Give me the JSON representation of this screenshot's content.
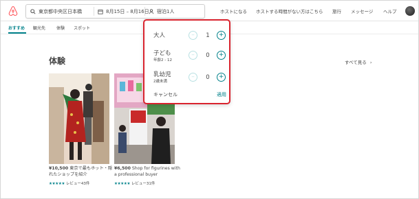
{
  "header": {
    "search": {
      "location": "東京都中央区日本橋",
      "dates": "8月15日 – 8月16日",
      "guests": "宿泊1人"
    },
    "nav": [
      "ホストになる",
      "ホストする時間がない方はこちら",
      "旅行",
      "メッセージ",
      "ヘルプ"
    ]
  },
  "tabs": [
    "おすすめ",
    "観光先",
    "体験",
    "スポット"
  ],
  "section": {
    "title": "体験",
    "see_all": "すべて見る"
  },
  "cards": [
    {
      "price": "¥10,500",
      "title": "東京で最もホット・隠れたショップを紹介",
      "stars": "★★★★★",
      "reviews": "レビュー43件"
    },
    {
      "price": "¥6,500",
      "title": "Shop for figurines with a professional buyer",
      "stars": "★★★★★",
      "reviews": "レビュー31件"
    }
  ],
  "guest_popup": {
    "rows": [
      {
        "label": "大人",
        "sub": "",
        "count": "1"
      },
      {
        "label": "子ども",
        "sub": "年齢2 - 12",
        "count": "0"
      },
      {
        "label": "乳幼児",
        "sub": "2歳未満",
        "count": "0"
      }
    ],
    "minus_symbol": "–",
    "plus_symbol": "+",
    "cancel_label": "キャンセル",
    "apply_label": "適用"
  },
  "colors": {
    "brand": "#ff5a5f",
    "accent": "#00818a",
    "highlight_border": "#d9232e"
  }
}
